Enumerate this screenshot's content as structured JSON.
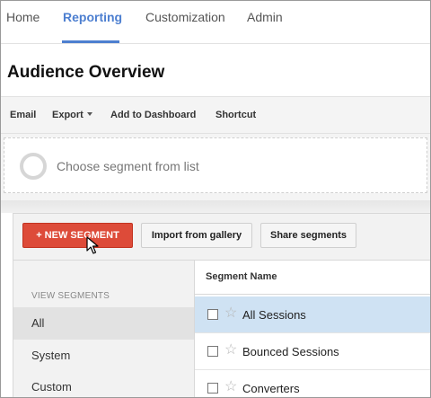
{
  "topnav": {
    "tabs": [
      "Home",
      "Reporting",
      "Customization",
      "Admin"
    ],
    "active_tab": "Reporting",
    "accent_color": "#4d7fd0"
  },
  "page": {
    "title": "Audience Overview"
  },
  "toolbar": {
    "email": "Email",
    "export": "Export",
    "add_to_dashboard": "Add to Dashboard",
    "shortcut": "Shortcut"
  },
  "segment_chooser": {
    "placeholder": "Choose segment from list"
  },
  "segment_panel": {
    "new_segment_label": "+ NEW SEGMENT",
    "new_segment_color": "#dd4b39",
    "import_label": "Import from gallery",
    "share_label": "Share segments",
    "view_segments_heading": "VIEW SEGMENTS",
    "categories": [
      "All",
      "System",
      "Custom"
    ],
    "selected_category": "All",
    "table_header": "Segment Name",
    "segments": [
      {
        "name": "All Sessions",
        "selected": true
      },
      {
        "name": "Bounced Sessions",
        "selected": false
      },
      {
        "name": "Converters",
        "selected": false
      }
    ]
  }
}
